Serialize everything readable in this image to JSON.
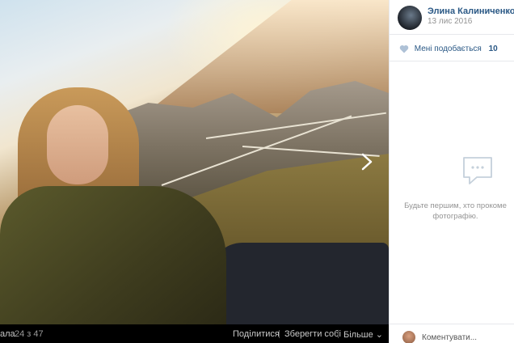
{
  "viewer": {
    "album_name": "ала",
    "counter": "24 з 47",
    "actions": {
      "share": "Поділитися",
      "save": "Зберегти собі",
      "more": "Більше ⌄"
    },
    "next_icon": "chevron-right-icon"
  },
  "post": {
    "author_name": "Элина Калиниченко",
    "date": "13 лис 2016",
    "likes_label": "Мені подобається",
    "likes_count": "10",
    "empty_comments_text": "Будьте першим, хто прокоме фотографію.",
    "comment_placeholder": "Коментувати..."
  },
  "colors": {
    "link_blue": "#2a5885",
    "muted_gray": "#939393",
    "viewer_bg": "#000000",
    "icon_blue": "#aec1d6"
  }
}
